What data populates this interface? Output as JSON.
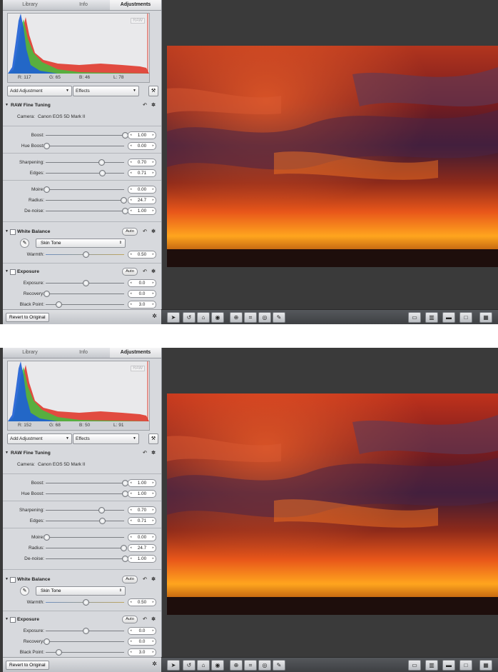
{
  "screens": [
    {
      "tabs": [
        "Library",
        "Info",
        "Adjustments"
      ],
      "histogram": {
        "badge": "RAW",
        "r": "R: 117",
        "g": "G: 65",
        "b": "B: 46",
        "l": "L: 78"
      },
      "add_adjustment": "Add Adjustment",
      "effects": "Effects",
      "raw": {
        "title": "RAW Fine Tuning",
        "camera_label": "Camera:",
        "camera_value": "Canon EOS 5D Mark II",
        "sliders": [
          {
            "label": "Boost:",
            "value": "1.00",
            "pos": 1.0
          },
          {
            "label": "Hue Boost:",
            "value": "0.00",
            "pos": 0.0
          },
          {
            "label": "Sharpening:",
            "value": "0.70",
            "pos": 0.7
          },
          {
            "label": "Edges:",
            "value": "0.71",
            "pos": 0.71
          },
          {
            "label": "Moire:",
            "value": "0.00",
            "pos": 0.0
          },
          {
            "label": "Radius:",
            "value": "24.7",
            "pos": 0.98
          },
          {
            "label": "De-noise:",
            "value": "1.00",
            "pos": 1.0
          }
        ]
      },
      "wb": {
        "title": "White Balance",
        "auto": "Auto",
        "preset": "Skin Tone",
        "warmth_label": "Warmth:",
        "warmth_value": "0.50",
        "pos": 0.5
      },
      "exposure": {
        "title": "Exposure",
        "auto": "Auto",
        "sliders": [
          {
            "label": "Exposure:",
            "value": "0.0",
            "pos": 0.5
          },
          {
            "label": "Recovery:",
            "value": "0.0",
            "pos": 0.0
          },
          {
            "label": "Black Point:",
            "value": "3.0",
            "pos": 0.15
          }
        ]
      },
      "revert": "Revert to Original"
    },
    {
      "tabs": [
        "Library",
        "Info",
        "Adjustments"
      ],
      "histogram": {
        "badge": "RAW",
        "r": "R: 152",
        "g": "G: 68",
        "b": "B: 50",
        "l": "L: 91"
      },
      "add_adjustment": "Add Adjustment",
      "effects": "Effects",
      "raw": {
        "title": "RAW Fine Tuning",
        "camera_label": "Camera:",
        "camera_value": "Canon EOS 5D Mark II",
        "sliders": [
          {
            "label": "Boost:",
            "value": "1.00",
            "pos": 1.0
          },
          {
            "label": "Hue Boost:",
            "value": "1.00",
            "pos": 1.0
          },
          {
            "label": "Sharpening:",
            "value": "0.70",
            "pos": 0.7
          },
          {
            "label": "Edges:",
            "value": "0.71",
            "pos": 0.71
          },
          {
            "label": "Moire:",
            "value": "0.00",
            "pos": 0.0
          },
          {
            "label": "Radius:",
            "value": "24.7",
            "pos": 0.98
          },
          {
            "label": "De-noise:",
            "value": "1.00",
            "pos": 1.0
          }
        ]
      },
      "wb": {
        "title": "White Balance",
        "auto": "Auto",
        "preset": "Skin Tone",
        "warmth_label": "Warmth:",
        "warmth_value": "0.50",
        "pos": 0.5
      },
      "exposure": {
        "title": "Exposure",
        "auto": "Auto",
        "sliders": [
          {
            "label": "Exposure:",
            "value": "0.0",
            "pos": 0.5
          },
          {
            "label": "Recovery:",
            "value": "0.0",
            "pos": 0.0
          },
          {
            "label": "Black Point:",
            "value": "3.0",
            "pos": 0.15
          }
        ]
      },
      "revert": "Revert to Original"
    }
  ]
}
